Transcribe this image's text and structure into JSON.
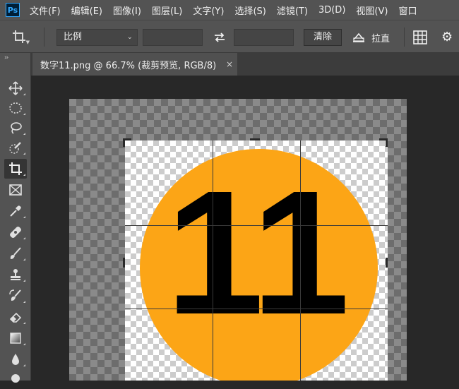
{
  "app": {
    "logo": "Ps",
    "menu": [
      "文件(F)",
      "编辑(E)",
      "图像(I)",
      "图层(L)",
      "文字(Y)",
      "选择(S)",
      "滤镜(T)",
      "3D(D)",
      "视图(V)",
      "窗口"
    ]
  },
  "options_bar": {
    "crop_tool_icon": "crop-icon",
    "ratio_select": "比例",
    "width_value": "",
    "height_value": "",
    "swap_icon": "swap-icon",
    "clear_label": "清除",
    "straighten_label": "拉直",
    "overlay_icon": "grid-overlay-icon",
    "settings_icon": "gear-icon"
  },
  "document": {
    "tab_title": "数字11.png @ 66.7% (裁剪预览, RGB/8)",
    "close_symbol": "×",
    "image_text": "11",
    "circle_color": "#fca516"
  },
  "toolbar": {
    "collapse_symbol": "››",
    "tools": [
      "move-icon",
      "marquee-icon",
      "lasso-icon",
      "quick-select-icon",
      "crop-icon",
      "frame-icon",
      "eyedropper-icon",
      "healing-brush-icon",
      "brush-icon",
      "clone-stamp-icon",
      "history-brush-icon",
      "eraser-icon",
      "gradient-icon",
      "blur-icon",
      "dodge-icon"
    ],
    "active_tool": "crop-icon"
  }
}
